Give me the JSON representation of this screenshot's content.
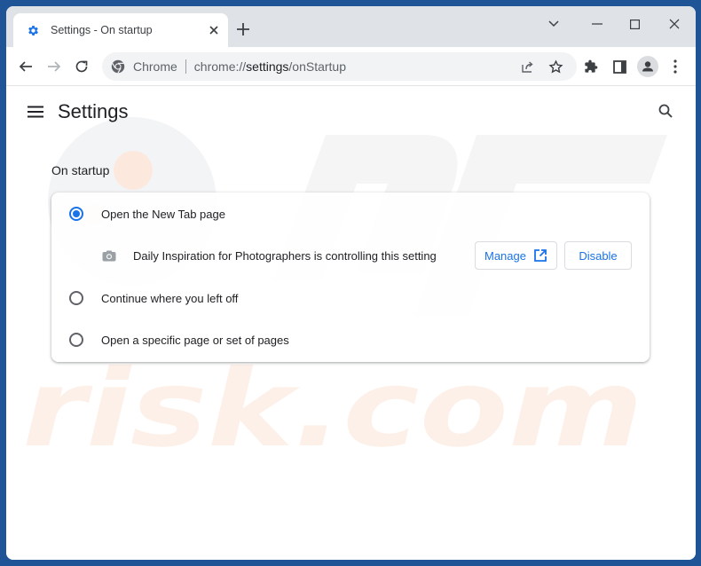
{
  "browser": {
    "tab": {
      "title": "Settings - On startup",
      "icon": "gear-icon",
      "close_label": "×"
    },
    "new_tab_label": "+",
    "window_controls": [
      "tab-search",
      "minimize",
      "maximize",
      "close"
    ],
    "nav": {
      "back_icon": "arrow-left-icon",
      "forward_icon": "arrow-right-icon",
      "reload_icon": "reload-icon"
    },
    "omnibox": {
      "site_label": "Chrome",
      "url_prefix": "chrome://",
      "url_host": "settings",
      "url_path": "/onStartup"
    },
    "toolbar_icons": [
      "share-icon",
      "star-icon",
      "extensions-icon",
      "side-panel-icon",
      "profile-icon",
      "more-icon"
    ]
  },
  "page": {
    "title": "Settings",
    "section_title": "On startup",
    "options": [
      {
        "label": "Open the New Tab page",
        "checked": true
      },
      {
        "label": "Continue where you left off",
        "checked": false
      },
      {
        "label": "Open a specific page or set of pages",
        "checked": false
      }
    ],
    "extension_notice": {
      "text": "Daily Inspiration for Photographers is controlling this setting",
      "manage_label": "Manage",
      "disable_label": "Disable"
    }
  },
  "watermark": {
    "text": "risk.com"
  },
  "colors": {
    "accent": "#1a73e8",
    "frame": "#1f5597",
    "titlebar": "#dfe3e8"
  }
}
